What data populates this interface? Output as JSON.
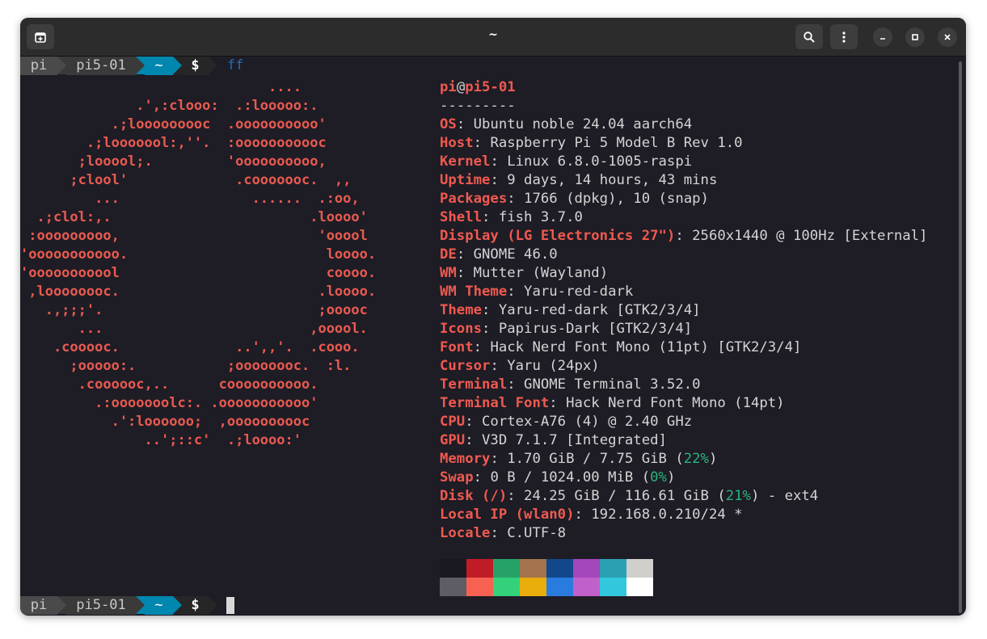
{
  "window": {
    "title": "~"
  },
  "icons": {
    "new_tab": "new-tab-icon",
    "search": "search-icon",
    "menu": "kebab-menu-icon",
    "minimize": "minimize-icon",
    "maximize": "maximize-icon",
    "close": "close-icon"
  },
  "prompt": {
    "user": "pi",
    "host": "pi5-01",
    "dir": "~",
    "symbol": "$",
    "command": "ff"
  },
  "logo": [
    "                              ....",
    "              .',:clooo:  .:looooo:.",
    "           .;looooooooc  .oooooooooo'",
    "        .;looooool:,''.  :ooooooooooc",
    "       ;looool;.         'oooooooooo,",
    "      ;clool'             .cooooooc.  ,,",
    "         ...                ......  .:oo,",
    "  .;clol:,.                        .loooo'",
    " :ooooooooo,                        'ooool",
    "'ooooooooooo.                        loooo.",
    "'ooooooooool                         coooo.",
    " ,loooooooc.                        .loooo.",
    "   .,;;;'.                          ;ooooc",
    "       ...                         ,ooool.",
    "    .cooooc.              ..',,'.  .cooo.",
    "      ;ooooo:.           ;oooooooc.  :l.",
    "       .coooooc,..      coooooooooo.",
    "         .:ooooooolc:. .ooooooooooo'",
    "           .':loooooo;  ,oooooooooc",
    "               ..';::c'  .;loooo:'"
  ],
  "user_host": {
    "user": "pi",
    "at": "@",
    "host": "pi5-01"
  },
  "separator": "---------",
  "info": [
    {
      "key": "OS",
      "value": "Ubuntu noble 24.04 aarch64"
    },
    {
      "key": "Host",
      "value": "Raspberry Pi 5 Model B Rev 1.0"
    },
    {
      "key": "Kernel",
      "value": "Linux 6.8.0-1005-raspi"
    },
    {
      "key": "Uptime",
      "value": "9 days, 14 hours, 43 mins"
    },
    {
      "key": "Packages",
      "value": "1766 (dpkg), 10 (snap)"
    },
    {
      "key": "Shell",
      "value": "fish 3.7.0"
    },
    {
      "key": "Display (LG Electronics 27\")",
      "value": "2560x1440 @ 100Hz [External]"
    },
    {
      "key": "DE",
      "value": "GNOME 46.0"
    },
    {
      "key": "WM",
      "value": "Mutter (Wayland)"
    },
    {
      "key": "WM Theme",
      "value": "Yaru-red-dark"
    },
    {
      "key": "Theme",
      "value": "Yaru-red-dark [GTK2/3/4]"
    },
    {
      "key": "Icons",
      "value": "Papirus-Dark [GTK2/3/4]"
    },
    {
      "key": "Font",
      "value": "Hack Nerd Font Mono (11pt) [GTK2/3/4]"
    },
    {
      "key": "Cursor",
      "value": "Yaru (24px)"
    },
    {
      "key": "Terminal",
      "value": "GNOME Terminal 3.52.0"
    },
    {
      "key": "Terminal Font",
      "value": "Hack Nerd Font Mono (14pt)"
    },
    {
      "key": "CPU",
      "value": "Cortex-A76 (4) @ 2.40 GHz"
    },
    {
      "key": "GPU",
      "value": "V3D 7.1.7 [Integrated]"
    },
    {
      "key": "Memory",
      "value": "1.70 GiB / 7.75 GiB (",
      "pct": "22%",
      "tail": ")"
    },
    {
      "key": "Swap",
      "value": "0 B / 1024.00 MiB (",
      "pct": "0%",
      "tail": ")"
    },
    {
      "key": "Disk (/)",
      "value": "24.25 GiB / 116.61 GiB (",
      "pct": "21%",
      "tail": ") - ext4"
    },
    {
      "key": "Local IP (wlan0)",
      "value": "192.168.0.210/24 *"
    },
    {
      "key": "Locale",
      "value": "C.UTF-8"
    }
  ],
  "palette": {
    "normal": [
      "#1a1922",
      "#c01c28",
      "#26a269",
      "#a2734c",
      "#12488b",
      "#a347ba",
      "#2aa1b3",
      "#d0cfcc"
    ],
    "bright": [
      "#5e5c64",
      "#f66151",
      "#33d17a",
      "#e9ad0c",
      "#2a7bde",
      "#c061cb",
      "#33c7de",
      "#ffffff"
    ]
  },
  "colors": {
    "accent": "#ef5a50",
    "percent": "#2ab57d",
    "prompt_dir_bg": "#0087af",
    "command": "#1e6fb8"
  }
}
